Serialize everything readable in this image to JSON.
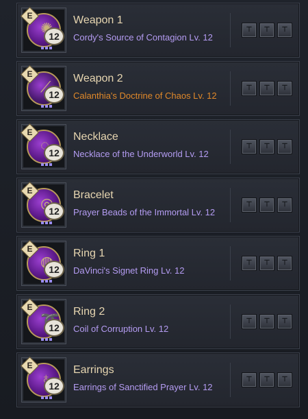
{
  "items": [
    {
      "name": "Weapon 1",
      "description": "Cordy's Source of Contagion Lv. 12",
      "level": "12",
      "badge": "E",
      "desc_color": "purple",
      "icon": "gem-cluster-icon",
      "glyph": "✺",
      "slot_glyph": "⊤"
    },
    {
      "name": "Weapon 2",
      "description": "Calanthia's Doctrine of Chaos Lv. 12",
      "level": "12",
      "badge": "E",
      "desc_color": "orange",
      "icon": "staff-icon",
      "glyph": "⟋",
      "slot_glyph": "⊤"
    },
    {
      "name": "Necklace",
      "description": "Necklace of the Underworld Lv. 12",
      "level": "12",
      "badge": "E",
      "desc_color": "purple",
      "icon": "necklace-icon",
      "glyph": "◌",
      "slot_glyph": "⊤"
    },
    {
      "name": "Bracelet",
      "description": "Prayer Beads of the Immortal Lv. 12",
      "level": "12",
      "badge": "E",
      "desc_color": "purple",
      "icon": "bracelet-icon",
      "glyph": "◎",
      "slot_glyph": "⊤"
    },
    {
      "name": "Ring 1",
      "description": "DaVinci's Signet Ring Lv. 12",
      "level": "12",
      "badge": "E",
      "desc_color": "purple",
      "icon": "ring-icon",
      "glyph": "◍",
      "slot_glyph": "⊤"
    },
    {
      "name": "Ring 2",
      "description": "Coil of Corruption Lv. 12",
      "level": "12",
      "badge": "E",
      "desc_color": "purple",
      "icon": "ring-coil-icon",
      "glyph": "➰",
      "slot_glyph": "⊤"
    },
    {
      "name": "Earrings",
      "description": "Earrings of Sanctified Prayer Lv. 12",
      "level": "12",
      "badge": "E",
      "desc_color": "purple",
      "icon": "earring-icon",
      "glyph": "♁",
      "slot_glyph": "⊤"
    }
  ],
  "slots_per_item": 3,
  "colors": {
    "name": "#e7d6b1",
    "desc_purple": "#b49cf2",
    "desc_orange": "#e0892a"
  }
}
